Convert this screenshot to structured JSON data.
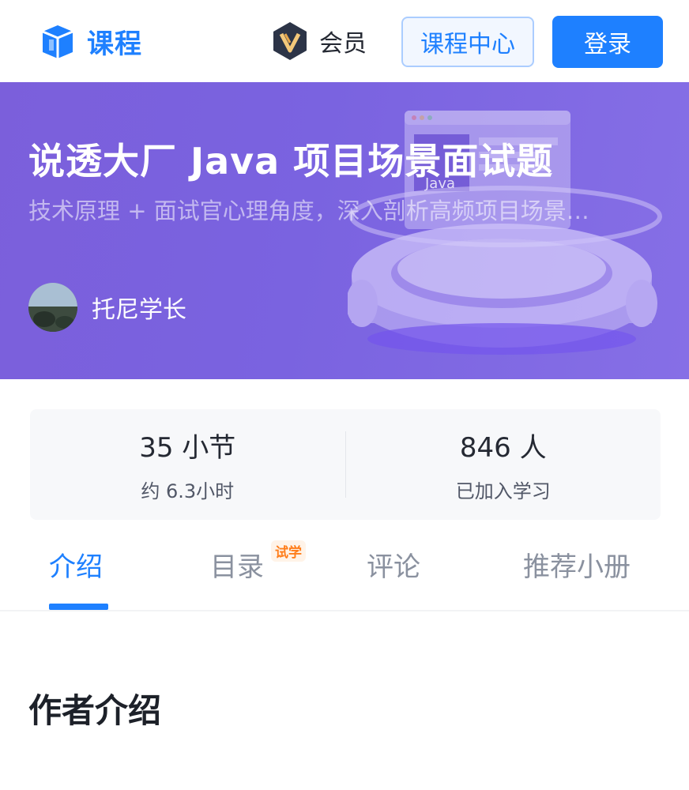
{
  "header": {
    "brand": "课程",
    "vip_label": "会员",
    "course_center_label": "课程中心",
    "login_label": "登录"
  },
  "banner": {
    "title": "说透大厂 Java 项目场景面试题",
    "subtitle": "技术原理 + 面试官心理角度，深入剖析高频项目场景…",
    "author": "托尼学长",
    "art_label": "Java"
  },
  "stats": {
    "lessons_value": "35 小节",
    "lessons_label": "约 6.3小时",
    "learners_value": "846 人",
    "learners_label": "已加入学习"
  },
  "tabs": {
    "items": [
      {
        "label": "介绍"
      },
      {
        "label": "目录"
      },
      {
        "label": "评论"
      },
      {
        "label": "推荐小册"
      }
    ],
    "trial_badge": "试学",
    "active": "介绍"
  },
  "section": {
    "title": "作者介绍"
  },
  "colors": {
    "accent": "#1e80ff",
    "banner": "#7b5fdb",
    "badge": "#ff7d1a"
  }
}
